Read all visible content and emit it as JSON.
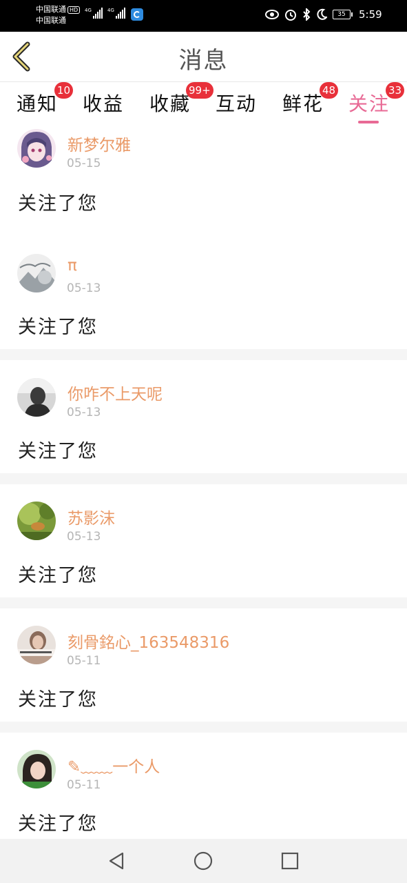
{
  "status_bar": {
    "carrier_1": "中国联通",
    "carrier_1_tag": "HD",
    "carrier_2": "中国联通",
    "net_1": "4G",
    "net_2": "4G",
    "battery": "35",
    "time": "5:59"
  },
  "header": {
    "title": "消息"
  },
  "tabs": [
    {
      "label": "通知",
      "badge": "10",
      "active": false
    },
    {
      "label": "收益",
      "badge": "",
      "active": false
    },
    {
      "label": "收藏",
      "badge": "99+",
      "active": false
    },
    {
      "label": "互动",
      "badge": "",
      "active": false
    },
    {
      "label": "鲜花",
      "badge": "48",
      "active": false
    },
    {
      "label": "关注",
      "badge": "33",
      "active": true
    }
  ],
  "messages": [
    {
      "name": "新梦尔雅",
      "date": "05-15",
      "text": "关注了您"
    },
    {
      "name": "π",
      "date": "05-13",
      "text": "关注了您"
    },
    {
      "name": "你咋不上天呢",
      "date": "05-13",
      "text": "关注了您"
    },
    {
      "name": "苏影沫",
      "date": "05-13",
      "text": "关注了您"
    },
    {
      "name": "刻骨銘心_163548316",
      "date": "05-11",
      "text": "关注了您"
    },
    {
      "name": "✎﹏﹏一个人",
      "date": "05-11",
      "text": "关注了您"
    }
  ],
  "colors": {
    "accent": "#e86a95",
    "name": "#ea9a68",
    "badge": "#e8303a",
    "date": "#b5b5b5"
  },
  "icons": {
    "back": "chevron-left-icon",
    "nav_back": "triangle-back-icon",
    "nav_home": "circle-home-icon",
    "nav_recent": "square-recent-icon"
  }
}
